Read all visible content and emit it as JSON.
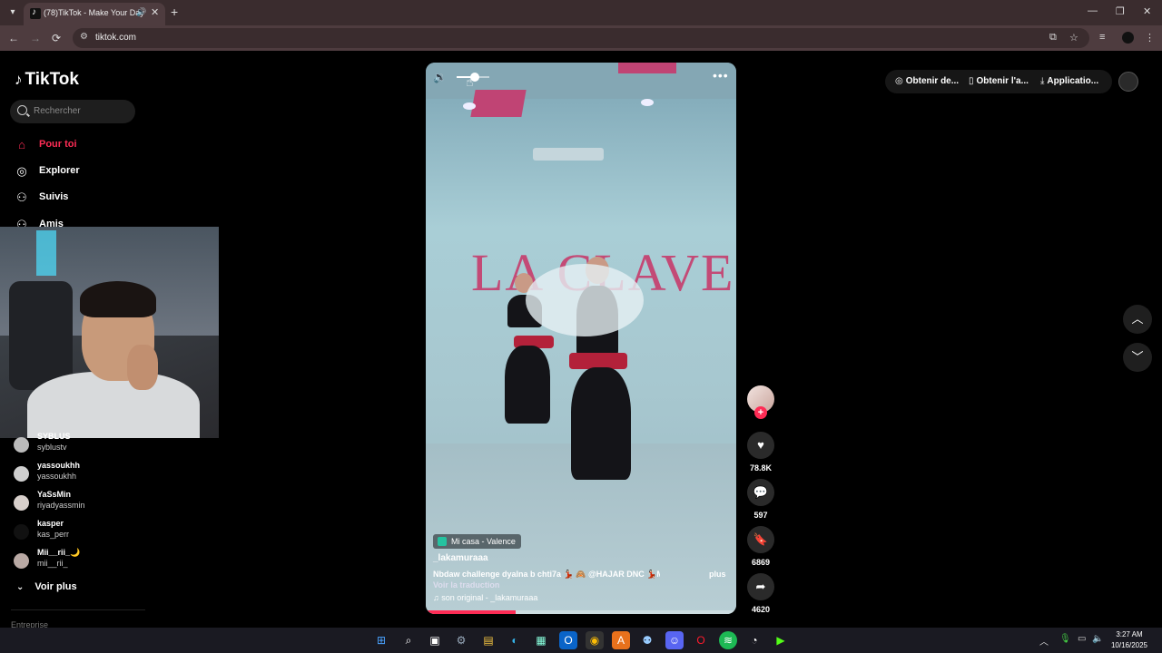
{
  "browser": {
    "tab_title": "(78)TikTok - Make Your Day",
    "url": "tiktok.com"
  },
  "sidebar": {
    "logo": "TikTok",
    "search_placeholder": "Rechercher",
    "nav": [
      {
        "label": "Pour toi",
        "icon": "home-icon",
        "active": true
      },
      {
        "label": "Explorer",
        "icon": "compass-icon"
      },
      {
        "label": "Suivis",
        "icon": "following-icon"
      },
      {
        "label": "Amis",
        "icon": "friends-icon"
      }
    ],
    "following": [
      {
        "name": "SYBLUS",
        "handle": "syblustv"
      },
      {
        "name": "yassoukhh",
        "handle": "yassoukhh"
      },
      {
        "name": "YaSsMin",
        "handle": "riyadyassmin"
      },
      {
        "name": "kasper",
        "handle": "kas_perr"
      },
      {
        "name": "Mii__rii_🌙",
        "handle": "mii__rii_"
      }
    ],
    "see_more": "Voir plus",
    "footer": "Entreprise"
  },
  "video": {
    "location": "Mi casa - Valence",
    "author": "_lakamuraaa",
    "description": "Nbdaw challenge dyalna b chti7a 💃🏻 🙈 @HAJAR DNC 💃🏻MA - ...",
    "more": "plus",
    "translate": "Voir la traduction",
    "music": "son original - _lakamuraaa",
    "studio_sign": "LA CLAVE",
    "volume": 0.55,
    "progress": 0.29
  },
  "actions": {
    "likes": "78.8K",
    "comments": "597",
    "saves": "6869",
    "shares": "4620"
  },
  "top_actions": {
    "item1": "Obtenir de...",
    "item2": "Obtenir l'a...",
    "item3": "Applicatio..."
  },
  "taskbar": {
    "time": "3:27 AM",
    "date": "10/16/2025"
  },
  "colors": {
    "accent": "#fe2c55"
  }
}
